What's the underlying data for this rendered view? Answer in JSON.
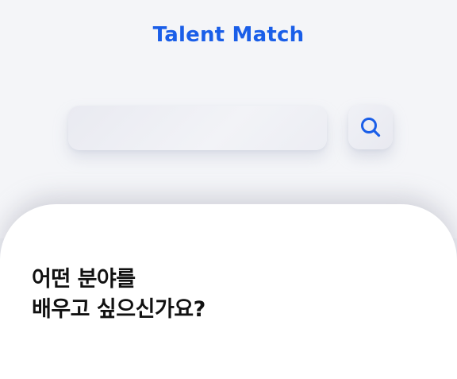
{
  "header": {
    "logo_text": "Talent Match"
  },
  "search": {
    "value": "",
    "placeholder": ""
  },
  "icons": {
    "search_button": "search-icon"
  },
  "colors": {
    "brand": "#1a5ee8",
    "card_background": "#ffffff",
    "page_background": "#f4f5f8",
    "heading_text": "#111111"
  },
  "main": {
    "question_line1": "어떤 분야를",
    "question_line2": "배우고 싶으신가요?"
  }
}
